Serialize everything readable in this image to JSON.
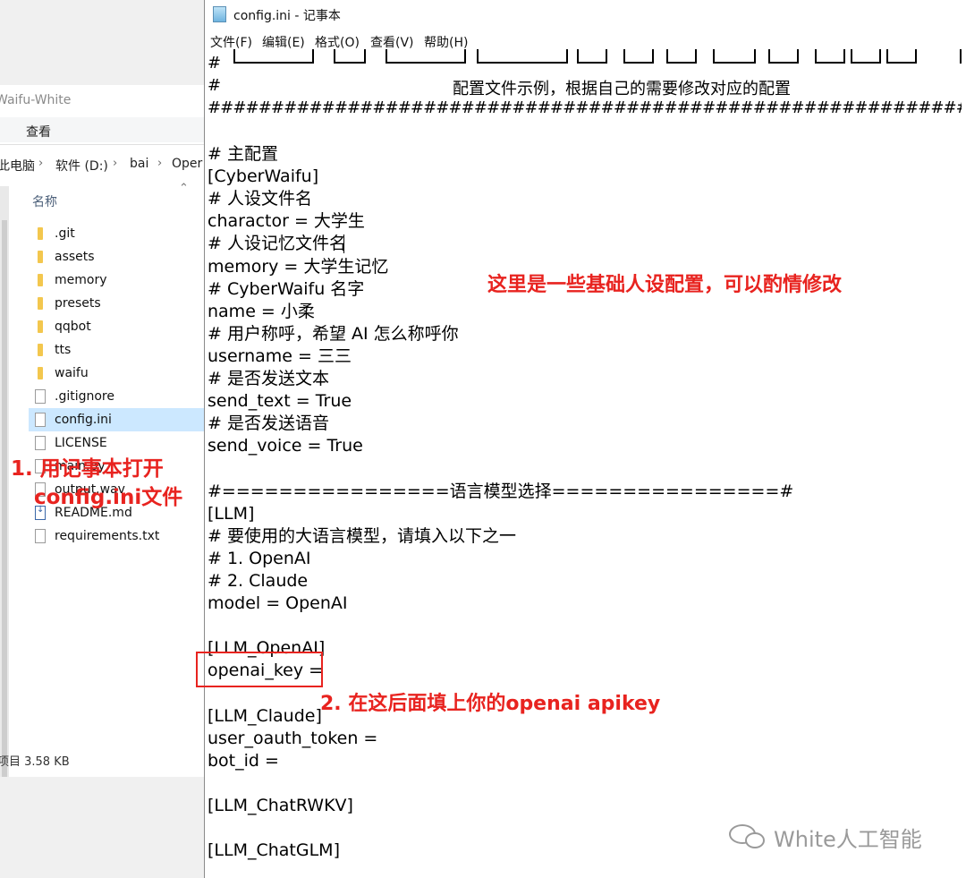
{
  "explorer": {
    "title": "Waifu-White",
    "ribbon_tab": "查看",
    "breadcrumb": [
      "此电脑",
      "软件 (D:)",
      "bai",
      "Oper"
    ],
    "column_header": "名称",
    "files": [
      {
        "name": ".git",
        "icon": "folder-icon"
      },
      {
        "name": "assets",
        "icon": "folder-icon"
      },
      {
        "name": "memory",
        "icon": "folder-icon"
      },
      {
        "name": "presets",
        "icon": "folder-icon"
      },
      {
        "name": "qqbot",
        "icon": "folder-icon"
      },
      {
        "name": "tts",
        "icon": "folder-icon"
      },
      {
        "name": "waifu",
        "icon": "folder-icon"
      },
      {
        "name": ".gitignore",
        "icon": "file-icon"
      },
      {
        "name": "config.ini",
        "icon": "config-file-icon",
        "selected": true
      },
      {
        "name": "LICENSE",
        "icon": "file-icon"
      },
      {
        "name": "main.py",
        "icon": "python-file-icon"
      },
      {
        "name": "output.wav",
        "icon": "audio-file-icon"
      },
      {
        "name": "README.md",
        "icon": "markdown-file-icon"
      },
      {
        "name": "requirements.txt",
        "icon": "file-icon"
      }
    ],
    "status": "项目  3.58 KB"
  },
  "notepad": {
    "title": "config.ini - 记事本",
    "menu": [
      "文件(F)",
      "编辑(E)",
      "格式(O)",
      "查看(V)",
      "帮助(H)"
    ],
    "header_comment": "配置文件示例，根据自己的需要修改对应的配置",
    "hash_line": "############################################################################################",
    "lines": [
      {
        "text": "# 主配置",
        "row": 0
      },
      {
        "text": "[CyberWaifu]",
        "row": 1
      },
      {
        "text": "# 人设文件名",
        "row": 2
      },
      {
        "text": "charactor = 大学生",
        "row": 3
      },
      {
        "text": "# 人设记忆文件名",
        "row": 4
      },
      {
        "text": "memory = 大学生记忆",
        "row": 5
      },
      {
        "text": "# CyberWaifu 名字",
        "row": 6
      },
      {
        "text": "name = 小柔",
        "row": 7
      },
      {
        "text": "# 用户称呼，希望 AI 怎么称呼你",
        "row": 8
      },
      {
        "text": "username = 三三",
        "row": 9
      },
      {
        "text": "# 是否发送文本",
        "row": 10
      },
      {
        "text": "send_text = True",
        "row": 11
      },
      {
        "text": "# 是否发送语音",
        "row": 12
      },
      {
        "text": "send_voice = True",
        "row": 13
      },
      {
        "text": "#================语言模型选择================#",
        "row": 15
      },
      {
        "text": "[LLM]",
        "row": 16
      },
      {
        "text": "# 要使用的大语言模型，请填入以下之一",
        "row": 17
      },
      {
        "text": "# 1. OpenAI",
        "row": 18
      },
      {
        "text": "# 2. Claude",
        "row": 19
      },
      {
        "text": "model = OpenAI",
        "row": 20
      },
      {
        "text": "[LLM_OpenAI]",
        "row": 22
      },
      {
        "text": "openai_key =",
        "row": 23
      },
      {
        "text": "[LLM_Claude]",
        "row": 25
      },
      {
        "text": "user_oauth_token =",
        "row": 26
      },
      {
        "text": "bot_id =",
        "row": 27
      },
      {
        "text": "[LLM_ChatRWKV]",
        "row": 29
      },
      {
        "text": "[LLM_ChatGLM]",
        "row": 31
      }
    ]
  },
  "annotations": {
    "step1_line1": "1. 用记事本打开",
    "step1_line2": "config.ini文件",
    "persona_note": "这里是一些基础人设配置，可以酌情修改",
    "step2": "2. 在这后面填上你的openai apikey",
    "color": "#e8231f"
  },
  "watermark": "White人工智能"
}
